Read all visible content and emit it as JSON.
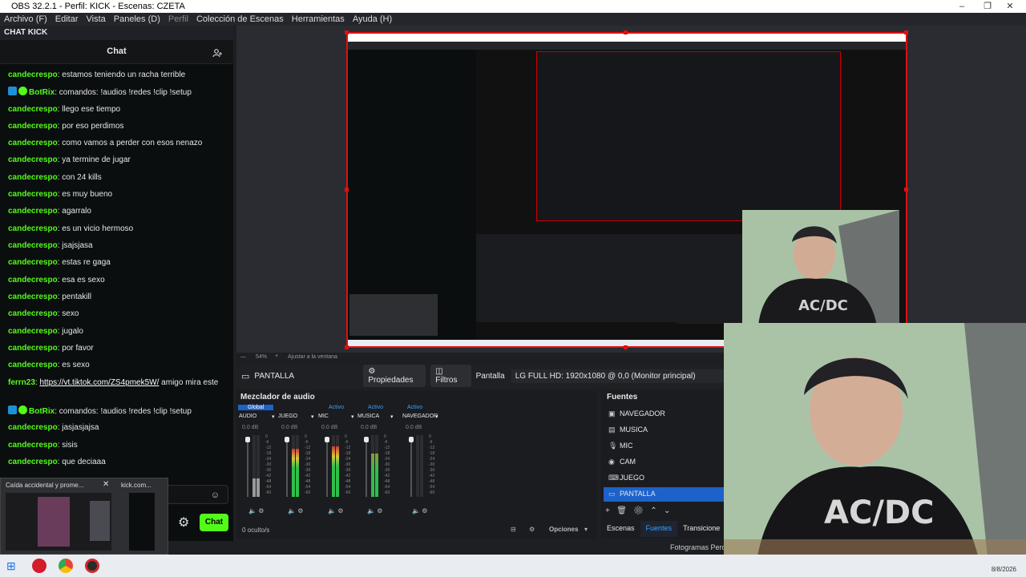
{
  "window": {
    "title": "OBS 32.2.1 - Perfil: KICK - Escenas: CZETA",
    "controls": [
      "–",
      "❐",
      "✕"
    ]
  },
  "menu": {
    "items": [
      "Archivo (F)",
      "Editar",
      "Vista",
      "Paneles (D)",
      "Perfil",
      "Colección de Escenas",
      "Herramientas",
      "Ayuda (H)"
    ]
  },
  "chat": {
    "dock_title": "CHAT KICK",
    "title": "Chat",
    "messages": [
      {
        "user": "candecrespo",
        "text": "estamos teniendo un racha terrible"
      },
      {
        "user": "BotRix",
        "text": "comandos: !audios !redes !clip !setup",
        "badges": true
      },
      {
        "user": "candecrespo",
        "text": "llego ese tiempo"
      },
      {
        "user": "candecrespo",
        "text": "por eso perdimos"
      },
      {
        "user": "candecrespo",
        "text": "como vamos a perder con esos nenazo"
      },
      {
        "user": "candecrespo",
        "text": "ya termine de jugar"
      },
      {
        "user": "candecrespo",
        "text": "con 24 kills"
      },
      {
        "user": "candecrespo",
        "text": "es muy bueno"
      },
      {
        "user": "candecrespo",
        "text": "agarralo"
      },
      {
        "user": "candecrespo",
        "text": "es un vicio hermoso"
      },
      {
        "user": "candecrespo",
        "text": "jsajsjasa"
      },
      {
        "user": "candecrespo",
        "text": "estas re gaga"
      },
      {
        "user": "candecrespo",
        "text": "esa es sexo"
      },
      {
        "user": "candecrespo",
        "text": "pentakill"
      },
      {
        "user": "candecrespo",
        "text": "sexo"
      },
      {
        "user": "candecrespo",
        "text": "jugalo"
      },
      {
        "user": "candecrespo",
        "text": "por favor"
      },
      {
        "user": "candecrespo",
        "text": "es sexo"
      },
      {
        "user": "ferrn23",
        "link": "https://vt.tiktok.com/ZS4pmek5W/",
        "text": " amigo mira este"
      },
      {
        "user": "BotRix",
        "text": "comandos: !audios !redes !clip !setup",
        "badges": true
      },
      {
        "user": "candecrespo",
        "text": "jasjasjajsa"
      },
      {
        "user": "candecrespo",
        "text": "sisis"
      },
      {
        "user": "candecrespo",
        "text": "que deciaaa"
      }
    ],
    "send_label": "Chat"
  },
  "preview": {
    "zoom": "54%",
    "fit": "Ajustar a la ventana"
  },
  "source_toolbar": {
    "source": "PANTALLA",
    "properties": "Propiedades",
    "filters": "Filtros",
    "display_label": "Pantalla",
    "display_value": "LG FULL HD: 1920x1080 @ 0,0 (Monitor principal)"
  },
  "mixer": {
    "title": "Mezclador de audio",
    "tab_global": "Global",
    "tab_active": "Activo",
    "channels": [
      {
        "name": "AUDIO",
        "db": "0.0 dB",
        "level": 0.3
      },
      {
        "name": "JUEGO",
        "db": "0.0 dB",
        "level": 0.78
      },
      {
        "name": "MIC",
        "db": "0.0 dB",
        "level": 0.82
      },
      {
        "name": "MUSICA",
        "db": "0.0 dB",
        "level": 0.7
      },
      {
        "name": "NAVEGADOR",
        "db": "0.0 dB",
        "level": 0.0
      }
    ],
    "scale": [
      "0",
      "-6",
      "-12",
      "-18",
      "-24",
      "-30",
      "-36",
      "-42",
      "-48",
      "-54",
      "-60"
    ],
    "hidden": "0 oculto/s",
    "options": "Opciones"
  },
  "sources": {
    "title": "Fuentes",
    "items": [
      {
        "name": "NAVEGADOR",
        "icon": "browser-icon"
      },
      {
        "name": "MUSICA",
        "icon": "window-icon"
      },
      {
        "name": "MIC",
        "icon": "mic-icon"
      },
      {
        "name": "CAM",
        "icon": "camera-icon"
      },
      {
        "name": "JUEGO",
        "icon": "gamepad-icon"
      },
      {
        "name": "PANTALLA",
        "icon": "monitor-icon",
        "selected": true
      }
    ],
    "tabs": [
      "Escenas",
      "Fuentes",
      "Transicione"
    ]
  },
  "status": {
    "frames": "Fotogramas Perd"
  },
  "popup": {
    "tab1": "Caída accidental y prome...",
    "tab2": "kick.com..."
  },
  "taskbar": {
    "date": "8/8/2026"
  }
}
